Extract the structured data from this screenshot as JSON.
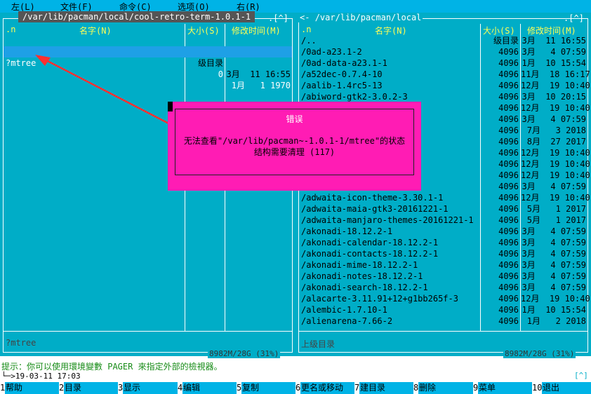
{
  "menu": {
    "left": "左(L)",
    "file": "文件(F)",
    "command": "命令(C)",
    "options": "选项(O)",
    "right": "右(R)"
  },
  "left_panel": {
    "path": "/var/lib/pacman/local/cool-retro-term-1.0.1-1",
    "corner": ".[^]",
    "col_sort": ".n",
    "col_name": "名字(N)",
    "col_size": "大小(S)",
    "col_date": "修改时间(M)",
    "rows": [
      {
        "name": "/..",
        "size": "级目录",
        "date": "3月  11 16:55"
      },
      {
        "name": "?mtree",
        "size": "0",
        "date": "1月   1 1970"
      }
    ],
    "mini_status": "?mtree",
    "disk": "8982M/28G (31%)"
  },
  "right_panel": {
    "path": "/var/lib/pacman/local",
    "corner": ".[^]",
    "col_sort": ".n",
    "col_name": "名字(N)",
    "col_size": "大小(S)",
    "col_date": "修改时间(M)",
    "rows": [
      {
        "name": "/..",
        "size": "级目录",
        "date": "3月  11 16:55"
      },
      {
        "name": "/0ad-a23.1-2",
        "size": "4096",
        "date": "3月   4 07:59"
      },
      {
        "name": "/0ad-data-a23.1-1",
        "size": "4096",
        "date": "1月  10 15:54"
      },
      {
        "name": "/a52dec-0.7.4-10",
        "size": "4096",
        "date": "11月  18 16:17"
      },
      {
        "name": "/aalib-1.4rc5-13",
        "size": "4096",
        "date": "12月  19 10:40"
      },
      {
        "name": "/abiword-gtk2-3.0.2-3",
        "size": "4096",
        "date": "3月  10 20:15"
      },
      {
        "name": "2",
        "size": "4096",
        "date": "12月  19 10:40"
      },
      {
        "name": "+g204a4ab-2",
        "size": "4096",
        "date": "3月   4 07:59"
      },
      {
        "name": "",
        "size": "4096",
        "date": "7月   3 2018"
      },
      {
        "name": "",
        "size": "4096",
        "date": "8月  27 2017"
      },
      {
        "name": "",
        "size": "4096",
        "date": "12月  19 10:40"
      },
      {
        "name": "nts-2.000-2",
        "size": "4096",
        "date": "12月  19 10:40"
      },
      {
        "name": "nts-1.001-2",
        "size": "4096",
        "date": "12月  19 10:40"
      },
      {
        "name": "o+1.095it-1",
        "size": "4096",
        "date": "3月   4 07:59"
      },
      {
        "name": "/adwaita-icon-theme-3.30.1-1",
        "size": "4096",
        "date": "12月  19 10:40"
      },
      {
        "name": "/adwaita-maia-gtk3-20161221-1",
        "size": "4096",
        "date": "5月   1 2017"
      },
      {
        "name": "/adwaita-manjaro-themes-20161221-1",
        "size": "4096",
        "date": "5月   1 2017"
      },
      {
        "name": "/akonadi-18.12.2-1",
        "size": "4096",
        "date": "3月   4 07:59"
      },
      {
        "name": "/akonadi-calendar-18.12.2-1",
        "size": "4096",
        "date": "3月   4 07:59"
      },
      {
        "name": "/akonadi-contacts-18.12.2-1",
        "size": "4096",
        "date": "3月   4 07:59"
      },
      {
        "name": "/akonadi-mime-18.12.2-1",
        "size": "4096",
        "date": "3月   4 07:59"
      },
      {
        "name": "/akonadi-notes-18.12.2-1",
        "size": "4096",
        "date": "3月   4 07:59"
      },
      {
        "name": "/akonadi-search-18.12.2-1",
        "size": "4096",
        "date": "3月   4 07:59"
      },
      {
        "name": "/alacarte-3.11.91+12+g1bb265f-3",
        "size": "4096",
        "date": "12月  19 10:40"
      },
      {
        "name": "/alembic-1.7.10-1",
        "size": "4096",
        "date": "1月  10 15:54"
      },
      {
        "name": "/alienarena-7.66-2",
        "size": "4096",
        "date": "1月   2 2018"
      }
    ],
    "mini_status": "上级目录",
    "disk": "8982M/28G (31%)"
  },
  "dialog": {
    "title": "错误",
    "line1": "无法查看\"/var/lib/pacman~-1.0.1-1/mtree\"的状态",
    "line2": "结构需要清理 (117)"
  },
  "hint": "提示：你可以使用環境變數 PAGER 來指定外部的檢視器。",
  "command_line": "└─>19-03-11 17:03",
  "command_corner": "[^]",
  "fkeys": [
    {
      "num": "1",
      "label": "帮助"
    },
    {
      "num": "2",
      "label": "目录"
    },
    {
      "num": "3",
      "label": "显示"
    },
    {
      "num": "4",
      "label": "编辑"
    },
    {
      "num": "5",
      "label": "复制"
    },
    {
      "num": "6",
      "label": "更名或移动"
    },
    {
      "num": "7",
      "label": "建目录"
    },
    {
      "num": "8",
      "label": "删除"
    },
    {
      "num": "9",
      "label": "菜单"
    },
    {
      "num": "10",
      "label": "退出"
    }
  ],
  "colors": {
    "panel_bg": "#00adc7",
    "menu_bg": "#00b3e6",
    "header_fg": "#ffff55",
    "selection": "#1ea0e6",
    "dialog_bg": "#ff1cb4",
    "arrow": "#ff3030"
  }
}
